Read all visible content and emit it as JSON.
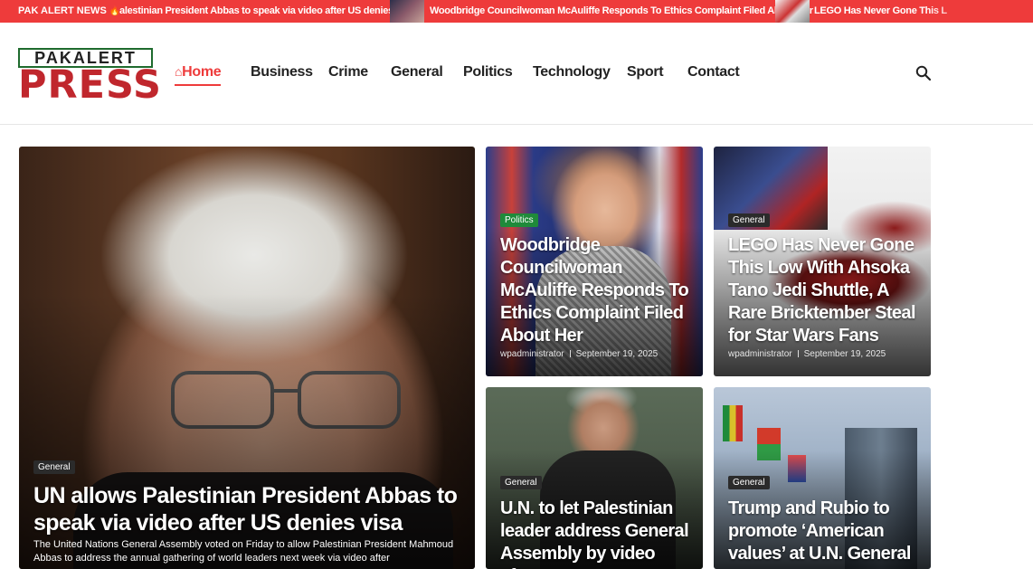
{
  "ticker": {
    "label": "PAK ALERT NEWS",
    "items": [
      "alestinian President Abbas to speak via video after US denies visa",
      "Woodbridge Councilwoman McAuliffe Responds To Ethics Complaint Filed About Her",
      "LEGO Has Never Gone This L"
    ]
  },
  "logo": {
    "top": "PAKALERT",
    "bottom": "PRESS"
  },
  "nav": [
    {
      "label": "Home",
      "active": true
    },
    {
      "label": "Business"
    },
    {
      "label": "Crime"
    },
    {
      "label": "General"
    },
    {
      "label": "Politics"
    },
    {
      "label": "Technology"
    },
    {
      "label": "Sport"
    },
    {
      "label": "Contact"
    }
  ],
  "colors": {
    "accent": "#ee3b3b",
    "politics_badge": "#1f8a3a",
    "dark_badge": "#2b2b2b"
  },
  "feature": {
    "category": "General",
    "title": "UN allows Palestinian President Abbas to speak via video after US denies visa",
    "excerpt": "The United Nations General Assembly voted on Friday to allow Palestinian President Mahmoud Abbas to address the annual gathering of world leaders next week via video after"
  },
  "cards": [
    {
      "category": "Politics",
      "title": "Woodbridge Councilwoman McAuliffe Responds To Ethics Complaint Filed About Her",
      "author": "wpadministrator",
      "date": "September 19, 2025"
    },
    {
      "category": "General",
      "title": "LEGO Has Never Gone This Low With Ahsoka Tano Jedi Shuttle, A Rare Bricktember Steal for Star Wars Fans",
      "author": "wpadministrator",
      "date": "September 19, 2025"
    },
    {
      "category": "General",
      "title": "U.N. to let Palestinian leader address General Assembly by video after"
    },
    {
      "category": "General",
      "title": "Trump and Rubio to promote ‘American values’ at U.N. General"
    }
  ]
}
